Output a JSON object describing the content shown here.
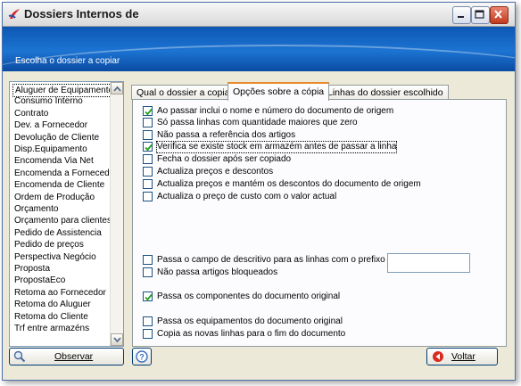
{
  "window": {
    "title": "Dossiers Internos de"
  },
  "banner": {
    "text": "Escolha o dossier a copiar"
  },
  "doclist": {
    "items": [
      "Aluguer de Equipamentos",
      "Consumo Interno",
      "Contrato",
      "Dev. a Fornecedor",
      "Devolução de Cliente",
      "Disp.Equipamento",
      "Encomenda Via Net",
      "Encomenda a Fornecedor",
      "Encomenda de Cliente",
      "Ordem de Produção",
      "Orçamento",
      "Orçamento para clientes",
      "Pedido de Assistencia",
      "Pedido de preços",
      "Perspectiva Negócio",
      "Proposta",
      "PropostaEco",
      "Retoma ao Fornecedor",
      "Retoma do Aluguer",
      "Retoma do Cliente",
      "Trf entre armazéns"
    ],
    "selected_index": 0
  },
  "tabs": [
    {
      "label": "Qual o dossier a copiar"
    },
    {
      "label": "Opções sobre a cópia"
    },
    {
      "label": "Linhas do dossier escolhido"
    }
  ],
  "active_tab": 1,
  "options": [
    {
      "label": "Ao passar inclui o nome e número do documento de origem",
      "checked": true
    },
    {
      "label": "Só passa linhas com quantidade maiores que zero",
      "checked": false
    },
    {
      "label": "Não passa a referência dos artigos",
      "checked": false
    },
    {
      "label": "Verifica se existe stock em armazém antes de passar a linha",
      "checked": true
    },
    {
      "label": "Fecha o dossier após ser copiado",
      "checked": false
    },
    {
      "label": "Actualiza preços e descontos",
      "checked": false
    },
    {
      "label": "Actualiza preços e mantém os descontos do documento de origem",
      "checked": false
    },
    {
      "label": "Actualiza o preço de custo com o valor actual",
      "checked": false
    },
    {
      "label": "Passa o campo de descritivo para as linhas com o prefixo",
      "checked": false
    },
    {
      "label": "Não passa artigos bloqueados",
      "checked": false
    },
    {
      "label": "Passa os componentes do documento original",
      "checked": true
    },
    {
      "label": "Passa os equipamentos do documento original",
      "checked": false
    },
    {
      "label": "Copia as novas linhas para o fim do documento",
      "checked": false
    }
  ],
  "prefix_field": {
    "value": ""
  },
  "buttons": {
    "observe": "Observar",
    "back": "Voltar"
  },
  "colors": {
    "banner": "#1c74d2",
    "tab_highlight": "#e68b2c",
    "checkmark": "#21a121",
    "panel_bg": "#ece9d8"
  }
}
